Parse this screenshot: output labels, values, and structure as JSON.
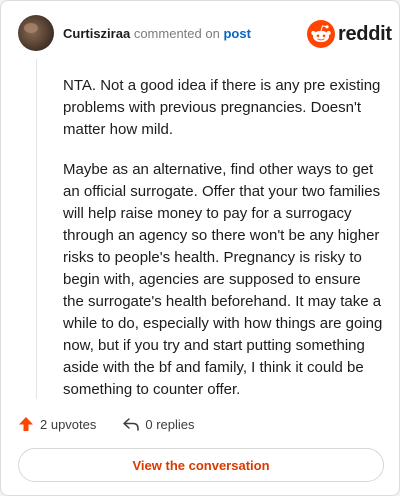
{
  "header": {
    "username": "Curtisziraa",
    "commented_text": "commented on",
    "post_link": "post"
  },
  "brand": {
    "wordmark": "reddit",
    "icon": "reddit-logo-icon",
    "accent_color": "#ff4500"
  },
  "comment": {
    "paragraphs": [
      "NTA. Not a good idea if there is any pre existing problems with previous pregnancies. Doesn't matter how mild.",
      "Maybe as an alternative, find other ways to get an official surrogate. Offer that your two families will help raise money to pay for a surrogacy through an agency so there won't be any higher risks to people's health. Pregnancy is risky to begin with, agencies are supposed to ensure the surrogate's health beforehand. It may take a while to do, especially with how things are going now, but if you try and start putting something aside with the bf and family, I think it could be something to counter offer."
    ]
  },
  "actions": {
    "upvotes": "2 upvotes",
    "upvote_icon": "upvote-arrow-icon",
    "replies": "0 replies",
    "reply_icon": "reply-arrow-icon"
  },
  "cta": {
    "label": "View the conversation",
    "color": "#d93a00"
  }
}
